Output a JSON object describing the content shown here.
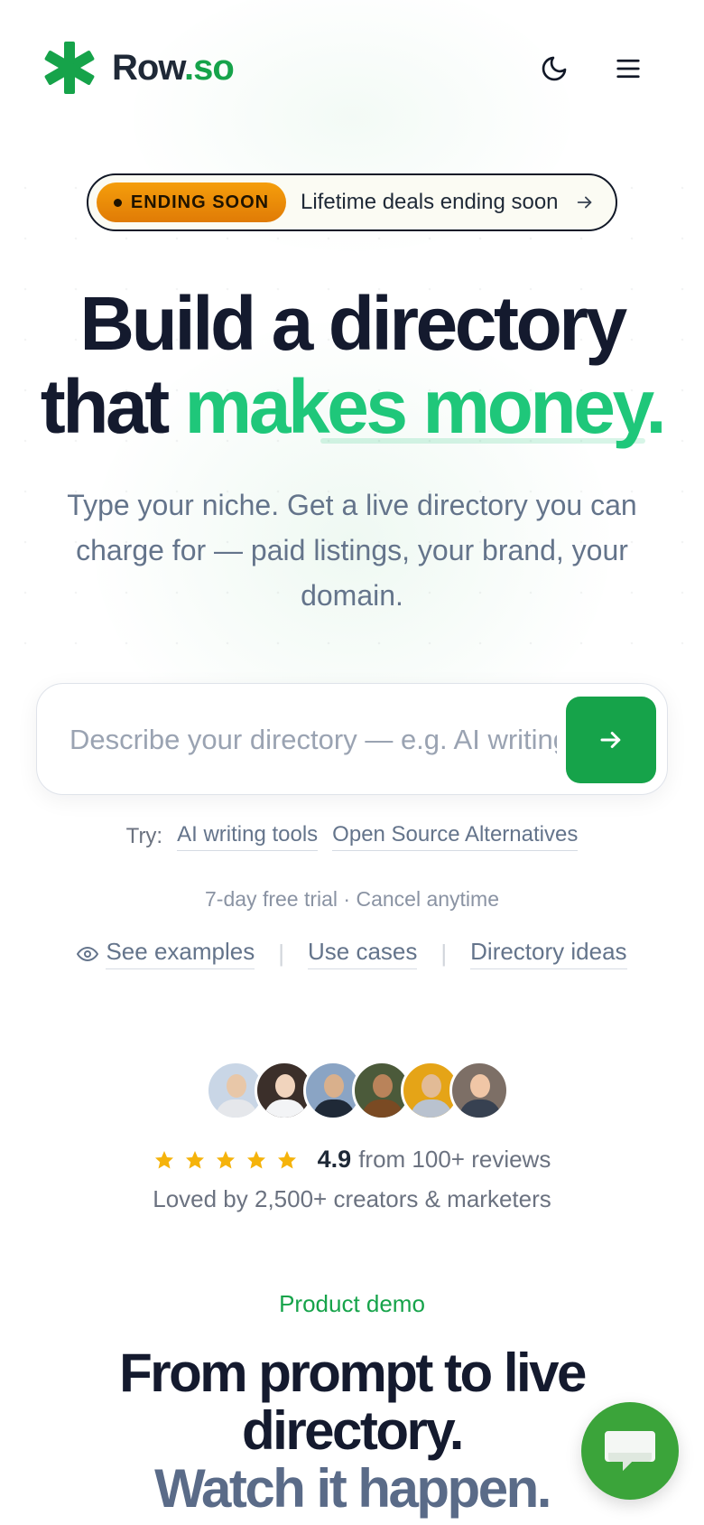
{
  "brand": {
    "name_main": "Row",
    "name_suffix": ".so",
    "accent_color": "#16a34a"
  },
  "header": {
    "theme_toggle_icon": "moon-icon",
    "menu_icon": "hamburger-menu-icon"
  },
  "promo": {
    "badge_label": "ENDING SOON",
    "text": "Lifetime deals ending soon",
    "badge_color": "#f59e0b"
  },
  "hero": {
    "title_line1": "Build a directory",
    "title_line2_plain": "that ",
    "title_line2_accent": "makes money.",
    "subtitle": "Type your niche. Get a live directory you can charge for — paid listings, your brand, your domain."
  },
  "search": {
    "placeholder": "Describe your directory — e.g. AI writing tools",
    "value": "",
    "submit_icon": "arrow-right-icon"
  },
  "suggestions": {
    "label": "Try:",
    "items": [
      "AI writing tools",
      "Open Source Alternatives"
    ]
  },
  "trial_note": "7-day free trial · Cancel anytime",
  "links": {
    "see_examples": "See examples",
    "use_cases": "Use cases",
    "directory_ideas": "Directory ideas",
    "separator": "|"
  },
  "social_proof": {
    "rating": "4.9",
    "stars": 5,
    "reviews_text": "from 100+ reviews",
    "loved_text": "Loved by 2,500+ creators & marketers",
    "star_color": "#f5b30b"
  },
  "demo_section": {
    "eyebrow": "Product demo",
    "title_line1": "From prompt to live directory.",
    "title_line2": "Watch it happen."
  },
  "chat": {
    "icon": "chat-bubble-icon",
    "color": "#3ba43a"
  }
}
